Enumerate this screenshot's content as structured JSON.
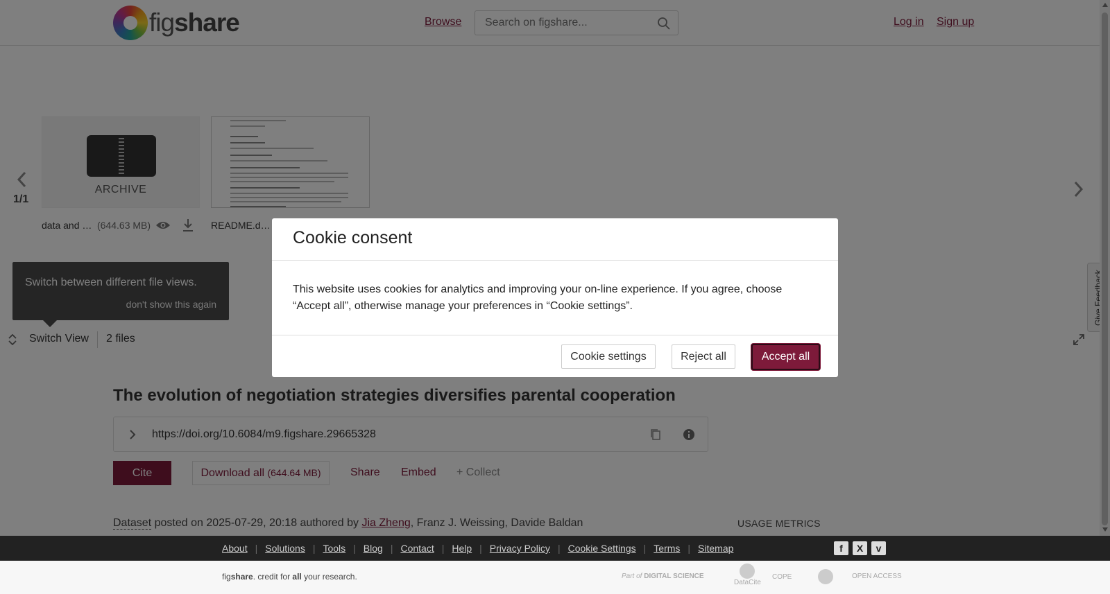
{
  "header": {
    "logo_text_light": "fig",
    "logo_text_bold": "share",
    "browse": "Browse",
    "search_placeholder": "Search on figshare...",
    "login": "Log in",
    "signup": "Sign up"
  },
  "viewer": {
    "pager": "1/1",
    "archive_label": "ARCHIVE",
    "files": [
      {
        "name": "data and …",
        "size": "(644.63 MB)"
      },
      {
        "name": "README.d…"
      }
    ],
    "tooltip_text": "Switch between different file views.",
    "tooltip_dismiss": "don't show this again",
    "switch_view": "Switch View",
    "files_count": "2 files",
    "feedback": "Give Feedback"
  },
  "article": {
    "title": "The evolution of negotiation strategies diversifies parental cooperation",
    "doi": "https://doi.org/10.6084/m9.figshare.29665328",
    "cite": "Cite",
    "download_all": "Download all",
    "download_size": "(644.64 MB)",
    "share": "Share",
    "embed": "Embed",
    "collect": "+ Collect",
    "item_type": "Dataset",
    "posted_text": " posted on 2025-07-29, 20:18 authored by ",
    "author_link": "Jia Zheng",
    "other_authors": ", Franz J. Weissing, Davide Baldan",
    "usage_metrics": "USAGE METRICS"
  },
  "cookie_modal": {
    "title": "Cookie consent",
    "body": "This website uses cookies for analytics and improving your on-line experience. If you agree, choose “Accept all”, otherwise manage your preferences in “Cookie settings”.",
    "settings_button": "Cookie settings",
    "reject_button": "Reject all",
    "accept_button": "Accept all"
  },
  "footer": {
    "links": [
      "About",
      "Solutions",
      "Tools",
      "Blog",
      "Contact",
      "Help",
      "Privacy Policy",
      "Cookie Settings",
      "Terms",
      "Sitemap"
    ],
    "tagline_pre": "fig",
    "tagline_bold": "share",
    "tagline_mid": ". credit for ",
    "tagline_all": "all",
    "tagline_post": " your research.",
    "partner_part_of": "Part of",
    "partner_digital_science": "DIGITAL SCIENCE",
    "partner_datacite": "DataCite",
    "partner_cope": "COPE",
    "partner_open_access": "OPEN ACCESS"
  },
  "colors": {
    "brand": "#7d1a3a",
    "footer_dark": "#222222",
    "overlay": "rgba(0,0,0,0.5)"
  },
  "icons": [
    "search-icon",
    "eye-icon",
    "download-icon",
    "chevron-left-icon",
    "chevron-right-icon",
    "switch-view-icon",
    "expand-icon",
    "chevron-right-icon",
    "copy-icon",
    "info-icon",
    "facebook-icon",
    "x-icon",
    "vimeo-icon"
  ]
}
